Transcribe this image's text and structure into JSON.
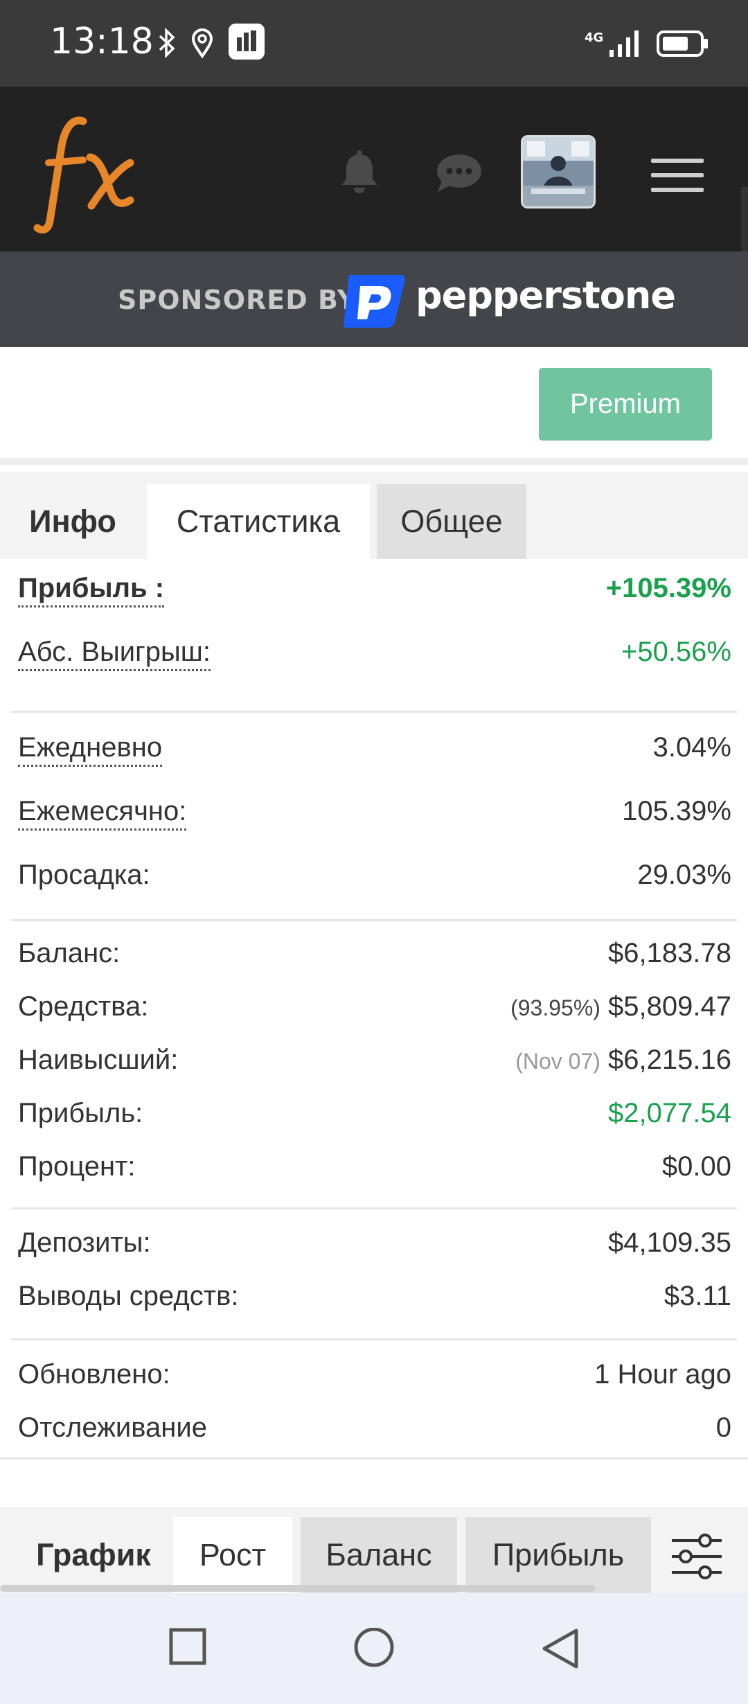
{
  "status_bar": {
    "time": "13:18",
    "network": "4G",
    "icons": [
      "bluetooth-icon",
      "location-icon",
      "app-icon",
      "signal-icon",
      "battery-icon"
    ]
  },
  "header": {
    "logo_text": "fx",
    "icons": [
      "bell-icon",
      "chat-icon",
      "avatar",
      "menu-icon"
    ]
  },
  "sponsor": {
    "label": "SPONSORED BY",
    "brand": "pepperstone"
  },
  "premium_button": "Premium",
  "tabs": [
    {
      "label": "Инфо"
    },
    {
      "label": "Статистика"
    },
    {
      "label": "Общее"
    }
  ],
  "stats": {
    "gain": {
      "label": "Прибыль :",
      "value": "+105.39%"
    },
    "abs_gain": {
      "label": "Абс. Выигрыш:",
      "value": "+50.56%"
    },
    "daily": {
      "label": "Ежедневно",
      "value": "3.04%"
    },
    "monthly": {
      "label": "Ежемесячно:",
      "value": "105.39%"
    },
    "drawdown": {
      "label": "Просадка:",
      "value": "29.03%"
    },
    "balance": {
      "label": "Баланс:",
      "value": "$6,183.78"
    },
    "equity": {
      "label": "Средства:",
      "note": "(93.95%)",
      "value": "$5,809.47"
    },
    "highest": {
      "label": "Наивысший:",
      "note": "(Nov 07)",
      "value": "$6,215.16"
    },
    "profit": {
      "label": "Прибыль:",
      "value": "$2,077.54"
    },
    "interest": {
      "label": "Процент:",
      "value": "$0.00"
    },
    "deposits": {
      "label": "Депозиты:",
      "value": "$4,109.35"
    },
    "withdrawals": {
      "label": "Выводы средств:",
      "value": "$3.11"
    },
    "updated": {
      "label": "Обновлено:",
      "value": "1 Hour ago"
    },
    "tracking": {
      "label": "Отслеживание",
      "value": "0"
    }
  },
  "chart_tabs": [
    {
      "label": "График"
    },
    {
      "label": "Рост"
    },
    {
      "label": "Баланс"
    },
    {
      "label": "Прибыль"
    }
  ],
  "colors": {
    "green": "#1aa14d",
    "premium": "#70c49f",
    "header_bg": "#222222",
    "sponsor_bg": "#43454a",
    "logo_orange": "#e8862a",
    "pepperstone_blue": "#1a5cff"
  }
}
